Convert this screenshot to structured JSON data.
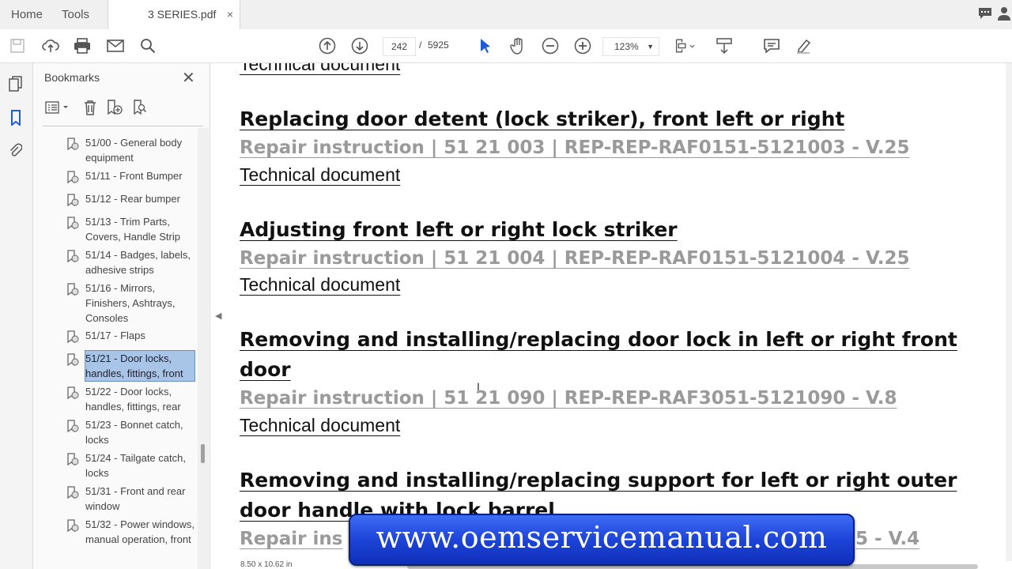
{
  "tabs": {
    "home": "Home",
    "tools": "Tools",
    "document": "3 SERIES.pdf",
    "close": "×"
  },
  "toolbar": {
    "page_current": "242",
    "page_sep": "/",
    "page_total": "5925",
    "zoom": "123%"
  },
  "bookmarks": {
    "title": "Bookmarks",
    "close": "✕",
    "items": [
      {
        "label": "51/00 - General body equipment"
      },
      {
        "label": "51/11 - Front Bumper"
      },
      {
        "label": "51/12 - Rear bumper"
      },
      {
        "label": "51/13 - Trim Parts, Covers, Handle Strip"
      },
      {
        "label": "51/14 - Badges, labels, adhesive strips"
      },
      {
        "label": "51/16 - Mirrors, Finishers, Ashtrays, Consoles"
      },
      {
        "label": "51/17 - Flaps"
      },
      {
        "label": "51/21 - Door locks, handles, fittings, front"
      },
      {
        "label": "51/22 - Door locks, handles, fittings, rear"
      },
      {
        "label": "51/23 - Bonnet catch, locks"
      },
      {
        "label": "51/24 - Tailgate catch, locks"
      },
      {
        "label": "51/31 - Front and rear window"
      },
      {
        "label": "51/32 - Power windows, manual operation, front"
      }
    ]
  },
  "document": {
    "top_partial": "Technical document",
    "entries": [
      {
        "heading": "Replacing door detent (lock striker), front left or right ",
        "repair": "Repair instruction | 51 21 003 | REP-REP-RAF0151-5121003 - V.25 ",
        "tech": "Technical document "
      },
      {
        "heading": "Adjusting front left or right lock striker ",
        "repair": "Repair instruction | 51 21 004 | REP-REP-RAF0151-5121004 - V.25 ",
        "tech": "Technical document "
      },
      {
        "heading_line1": "Removing and installing/replacing door lock in left or right front",
        "heading_line2": "door ",
        "repair": "Repair instruction | 51 21 090 | REP-REP-RAF3051-5121090 - V.8 ",
        "tech": "Technical document "
      },
      {
        "heading_line1": "Removing and installing/replacing support for left or right outer",
        "heading_line2": "door handle with lock barrel",
        "repair_left": "Repair ins",
        "repair_right": "5 - V.4"
      }
    ],
    "page_size": "8.50 x 10.62 in"
  },
  "watermark": "www.oemservicemanual.com"
}
